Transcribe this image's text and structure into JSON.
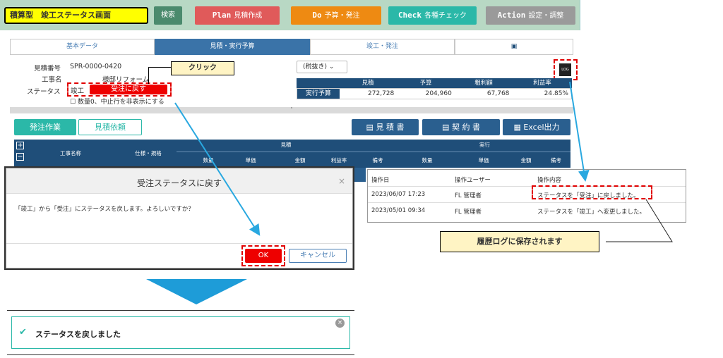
{
  "header": {
    "title": "積算型　竣工ステータス画面",
    "search": "検索",
    "plan_prefix": "Plan",
    "plan_label": "見積作成",
    "do_prefix": "Do",
    "do_label": "予算・発注",
    "check_prefix": "Check",
    "check_label": "各種チェック",
    "action_prefix": "Action",
    "action_label": "設定・調整",
    "colors": {
      "bg": "#b8d8c4",
      "title": "#ffff00",
      "search": "#4b8a6d",
      "plan": "#e05a5a",
      "do": "#ee8a12",
      "check": "#2bb8a8",
      "action": "#9a9a9a"
    }
  },
  "tabs": [
    "基本データ",
    "見積・実行予算",
    "竣工・発注",
    "📄"
  ],
  "info": {
    "estimate_no_label": "見積番号",
    "estimate_no": "SPR-0000-0420",
    "project_label": "工事名",
    "project": "様邸リフォーム",
    "status_label": "ステータス",
    "status_value": "竣工",
    "revert_button": "受注に戻す",
    "hide_zero": "数量0、中止行を非表示にする",
    "callout": "クリック"
  },
  "tax": "(税抜き)",
  "summary": {
    "headers": [
      "見積",
      "予算",
      "粗利額",
      "利益率"
    ],
    "row_label": "実行予算",
    "values": [
      "272,728",
      "204,960",
      "67,768",
      "24.85%"
    ]
  },
  "actions": {
    "order_tab": "発注作業",
    "request_tab": "見積依頼",
    "estimate_doc": "見 積 書",
    "contract_doc": "契 約 書",
    "excel": "Excel出力"
  },
  "grid": {
    "group_estimate": "見積",
    "group_actual": "実行",
    "col_name": "工事名称",
    "col_spec": "仕様・規格",
    "est_cols": [
      "数量",
      "単価",
      "金額",
      "利益率",
      "備考"
    ],
    "act_cols": [
      "数量",
      "単価",
      "金額",
      "備考"
    ]
  },
  "dialog": {
    "title": "受注ステータスに戻す",
    "message": "「竣工」から「受注」にステータスを戻します。よろしいですか？",
    "ok": "OK",
    "cancel": "キャンセル"
  },
  "log": {
    "headers": [
      "操作日",
      "操作ユーザー",
      "操作内容"
    ],
    "rows": [
      [
        "2023/06/07 17:23",
        "FL 管理者",
        "ステータスを「受注」に戻しました。"
      ],
      [
        "2023/05/01 09:34",
        "FL 管理者",
        "ステータスを「竣工」へ変更しました。"
      ]
    ],
    "note": "履歴ログに保存されます",
    "log_icon": "LOG"
  },
  "toast": {
    "message": "ステータスを戻しました"
  }
}
